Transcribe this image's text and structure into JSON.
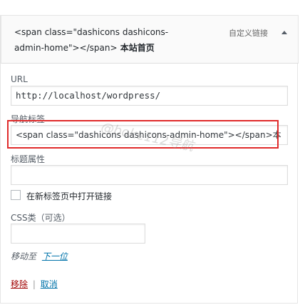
{
  "menu_item": {
    "title_code_line1": "<span class=\"dashicons dashicons-",
    "title_code_line2": "admin-home\"></span>",
    "title_label": "本站首页",
    "type_label": "自定义链接",
    "toggle_icon": "arrow-up-icon"
  },
  "fields": {
    "url_label": "URL",
    "url_value": "http://localhost/wordpress/",
    "nav_label": "导航标签",
    "nav_value": "<span class=\"dashicons dashicons-admin-home\"></span>本",
    "title_attr_label": "标题属性",
    "title_attr_value": "",
    "new_tab_label": "在新标签页中打开链接",
    "new_tab_checked": false,
    "css_label": "CSS类（可选）",
    "css_value": ""
  },
  "move": {
    "label": "移动至",
    "link": "下一位"
  },
  "actions": {
    "remove": "移除",
    "separator": "|",
    "cancel": "取消"
  },
  "watermark": {
    "text": "@boke112导航"
  },
  "colors": {
    "highlight": "#e02b2b",
    "link": "#0073aa",
    "remove": "#a00000"
  }
}
